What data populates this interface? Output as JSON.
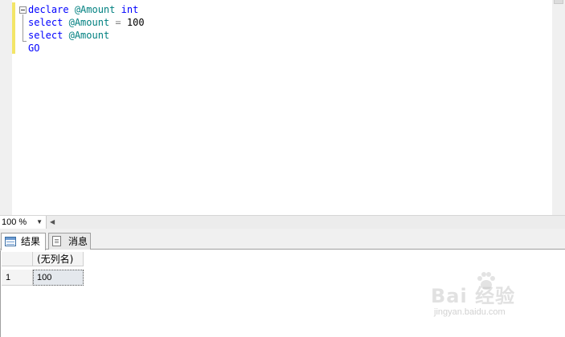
{
  "editor": {
    "lines": [
      [
        {
          "t": "declare",
          "c": "kw"
        },
        {
          "t": " ",
          "c": "plain"
        },
        {
          "t": "@Amount",
          "c": "var"
        },
        {
          "t": " ",
          "c": "plain"
        },
        {
          "t": "int",
          "c": "kw"
        }
      ],
      [
        {
          "t": "select",
          "c": "kw"
        },
        {
          "t": " ",
          "c": "plain"
        },
        {
          "t": "@Amount",
          "c": "var"
        },
        {
          "t": " ",
          "c": "plain"
        },
        {
          "t": "=",
          "c": "gray"
        },
        {
          "t": " 100",
          "c": "num"
        }
      ],
      [
        {
          "t": "select",
          "c": "kw"
        },
        {
          "t": " ",
          "c": "plain"
        },
        {
          "t": "@Amount",
          "c": "var"
        }
      ],
      [
        {
          "t": "GO",
          "c": "kw"
        }
      ]
    ]
  },
  "zoom": {
    "value": "100 %",
    "dropdown_icon": "chevron-down-icon",
    "scroll_left_icon": "arrow-left-icon"
  },
  "tabs": [
    {
      "label": "结果",
      "icon": "grid-icon",
      "active": true
    },
    {
      "label": "消息",
      "icon": "document-icon",
      "active": false
    }
  ],
  "results": {
    "columns": [
      "(无列名)"
    ],
    "rows": [
      {
        "row_number": "1",
        "cells": [
          "100"
        ]
      }
    ]
  },
  "watermark": {
    "text": "Bai 经验",
    "sub": "jingyan.baidu.com"
  },
  "colors": {
    "keyword": "#0000ff",
    "variable": "#008080",
    "change_marker": "#f3e567",
    "selected_cell": "#e4e8ed"
  }
}
